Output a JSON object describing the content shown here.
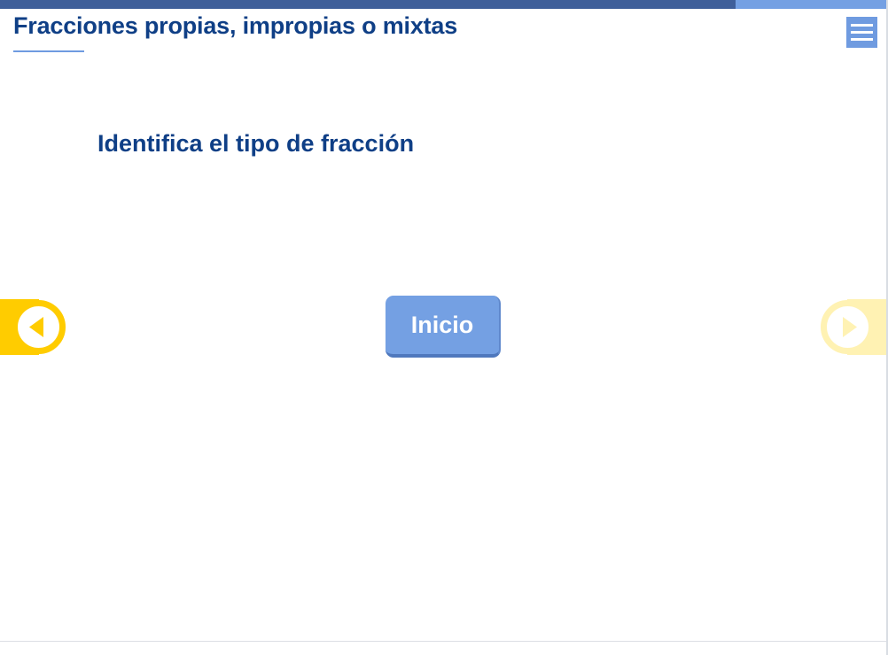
{
  "header": {
    "title": "Fracciones propias, impropias o mixtas",
    "progress_fraction": 0.83,
    "menu_icon": "hamburger-icon"
  },
  "main": {
    "subtitle": "Identifica el tipo de fracción",
    "start_button_label": "Inicio"
  },
  "navigation": {
    "previous_icon": "chevron-left-icon",
    "next_icon": "chevron-right-icon",
    "next_enabled": false
  },
  "colors": {
    "title": "#0f3f86",
    "accent_blue": "#74a0e3",
    "progress_dark": "#3f5f9a",
    "nav_yellow": "#ffcc00",
    "nav_yellow_disabled": "#fff2b3"
  }
}
